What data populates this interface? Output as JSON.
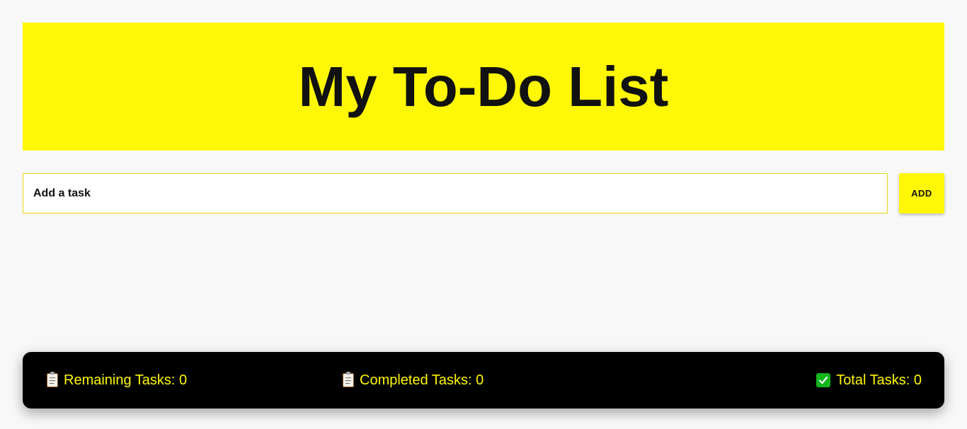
{
  "header": {
    "title": "My To-Do List",
    "background_color": "#fff705"
  },
  "task_input": {
    "placeholder": "Add a task",
    "value": ""
  },
  "add_button": {
    "label": "ADD"
  },
  "stats": {
    "remaining": {
      "icon": "clipboard-icon",
      "label": "Remaining Tasks: 0"
    },
    "completed": {
      "icon": "clipboard-icon",
      "label": "Completed Tasks: 0"
    },
    "total": {
      "icon": "check-mark-icon",
      "label": "Total Tasks: 0"
    }
  },
  "colors": {
    "accent": "#fff705",
    "footer_background": "#000000",
    "page_background": "#f8f8f8"
  }
}
